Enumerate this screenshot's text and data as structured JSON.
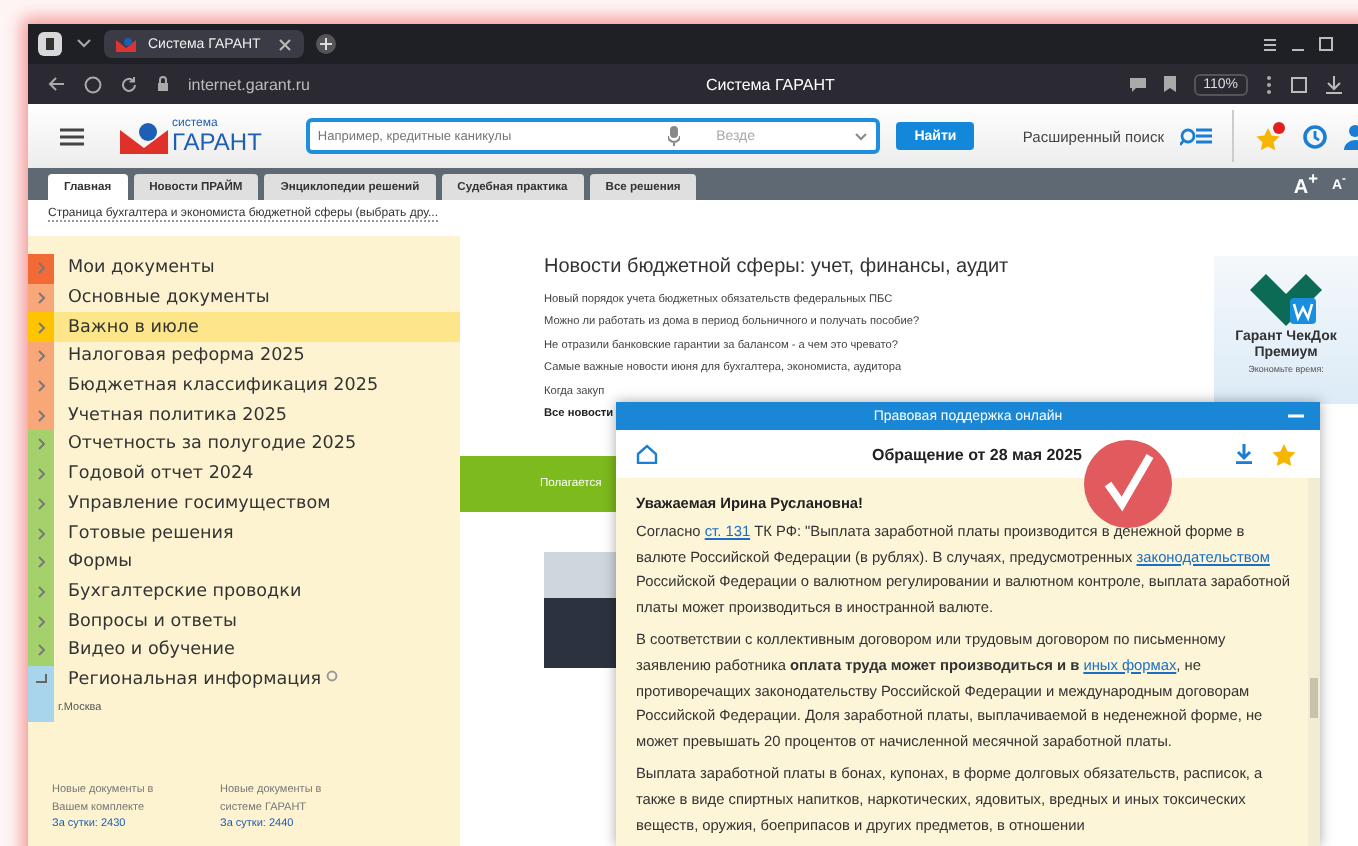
{
  "browser": {
    "tab_title": "Система ГАРАНТ",
    "url": "internet.garant.ru",
    "page_title": "Система ГАРАНТ",
    "zoom": "110%"
  },
  "header": {
    "logo_small": "система",
    "logo_big": "ГАРАНТ",
    "search": {
      "placeholder": "Например, кредитные каникулы"
    },
    "scope": "Везде",
    "search_button": "Найти",
    "advanced_search": "Расширенный поиск"
  },
  "tabs": [
    {
      "label": "Главная",
      "selected": true
    },
    {
      "label": "Новости ПРАЙМ",
      "selected": false
    },
    {
      "label": "Энциклопедии решений",
      "selected": false
    },
    {
      "label": "Судебная практика",
      "selected": false
    },
    {
      "label": "Все решения",
      "selected": false
    }
  ],
  "font_size": {
    "increase": "A$^{+}$",
    "decrease": "A$^{-}$"
  },
  "breadcrumb": "Страница бухгалтера и экономиста бюджетной сферы (выбрать дру...",
  "sidebar": {
    "items": [
      {
        "label": "Мои документы",
        "color": "#f26a36",
        "selected": false,
        "expanded": false
      },
      {
        "label": "Основные документы",
        "color": "#f8a878",
        "selected": false,
        "expanded": false
      },
      {
        "label": "Важно в июле",
        "color": "#ffc400",
        "selected": true,
        "expanded": false
      },
      {
        "label": "Налоговая реформа 2025",
        "color": "#f8a878",
        "selected": false,
        "expanded": false
      },
      {
        "label": "Бюджетная классификация 2025",
        "color": "#f8a878",
        "selected": false,
        "expanded": false
      },
      {
        "label": "Учетная политика 2025",
        "color": "#f8a878",
        "selected": false,
        "expanded": false
      },
      {
        "label": "Отчетность за полугодие 2025",
        "color": "#a5d16c",
        "selected": false,
        "expanded": false
      },
      {
        "label": "Годовой отчет 2024",
        "color": "#a5d16c",
        "selected": false,
        "expanded": false
      },
      {
        "label": "Управление госимуществом",
        "color": "#a5d16c",
        "selected": false,
        "expanded": false
      },
      {
        "label": "Готовые решения",
        "color": "#a5d16c",
        "selected": false,
        "expanded": false
      },
      {
        "label": "Формы",
        "color": "#a5d16c",
        "selected": false,
        "expanded": false
      },
      {
        "label": "Бухгалтерские проводки",
        "color": "#a5d16c",
        "selected": false,
        "expanded": false
      },
      {
        "label": "Вопросы и ответы",
        "color": "#a5d16c",
        "selected": false,
        "expanded": false
      },
      {
        "label": "Видео и обучение",
        "color": "#a5d16c",
        "selected": false,
        "expanded": false
      },
      {
        "label": "Региональная информация",
        "color": "#a8d4ec",
        "selected": false,
        "expanded": true,
        "children": [
          {
            "label": "г.Москва"
          }
        ]
      }
    ]
  },
  "stats": [
    {
      "title": "Новые документы в Вашем комплекте",
      "count": "За сутки: 2430"
    },
    {
      "title": "Новые документы в системе ГАРАНТ",
      "count": "За сутки: 2440"
    }
  ],
  "news": {
    "title": "Новости бюджетной сферы: учет, финансы, аудит",
    "items": [
      "Новый порядок учета бюджетных обязательств федеральных ПБС",
      "Можно ли работать из дома в период больничного и получать пособие?",
      "Не отразили банковские гарантии за балансом - а чем это чревато?",
      "Самые важные новости июня для бухгалтера, экономиста, аудитора",
      "Когда закуп"
    ],
    "all_link": "Все новости"
  },
  "banner": {
    "text": "Полагается"
  },
  "ad": {
    "title": "Гарант ЧекДок Премиум",
    "subtitle": "Экономьте время:"
  },
  "popup": {
    "header": "Правовая поддержка онлайн",
    "title": "Обращение от 28 мая 2025",
    "greeting": "Уважаемая Ирина Руслановна!",
    "paragraphs": [
      [
        {
          "kind": "text",
          "text": "Согласно "
        },
        {
          "kind": "link",
          "text": "ст. 131"
        },
        {
          "kind": "text",
          "text": " ТК РФ: \"Выплата заработной платы производится в денежной форме в валюте Российской Федерации (в рублях). В случаях, предусмотренных "
        },
        {
          "kind": "link",
          "text": "законодательством"
        },
        {
          "kind": "text",
          "text": " Российской Федерации о валютном регулировании и валютном контроле, выплата заработной платы может производиться в иностранной валюте."
        }
      ],
      [
        {
          "kind": "text",
          "text": "В соответствии с коллективным договором или трудовым договором по письменному заявлению работника "
        },
        {
          "kind": "bold",
          "text": "оплата труда может производиться и в "
        },
        {
          "kind": "link",
          "text": "иных формах"
        },
        {
          "kind": "text",
          "text": ", не противоречащих законодательству Российской Федерации и международным договорам Российской Федерации. Доля заработной платы, выплачиваемой в неденежной форме, не может превышать 20 процентов от начисленной месячной заработной платы."
        }
      ],
      [
        {
          "kind": "text",
          "text": "Выплата заработной платы в бонах, купонах, в форме долговых обязательств, расписок, а также в виде спиртных напитков, наркотических, ядовитых, вредных и иных токсических веществ, оружия, боеприпасов и других предметов, в отношении"
        }
      ]
    ]
  }
}
